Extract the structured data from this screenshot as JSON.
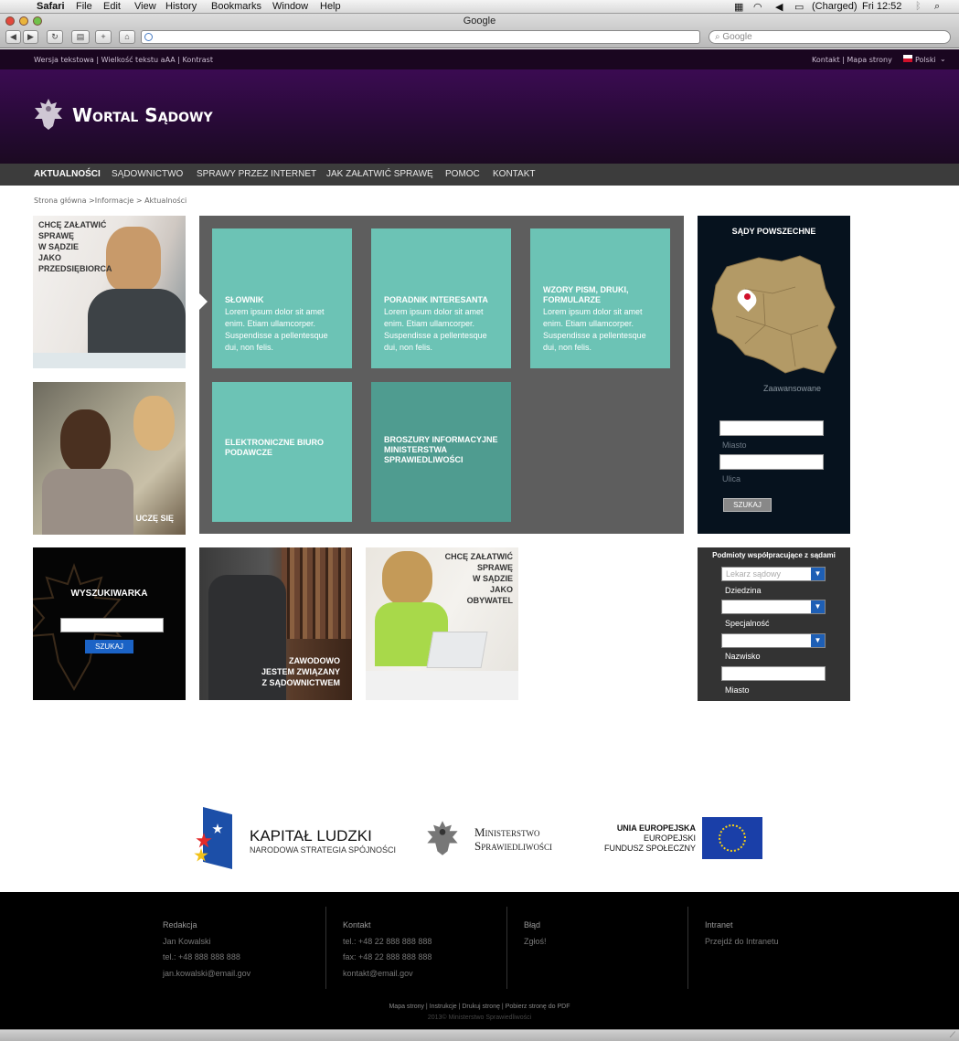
{
  "menubar": {
    "app": "Safari",
    "items": [
      "File",
      "Edit",
      "View",
      "History",
      "Bookmarks",
      "Window",
      "Help"
    ],
    "battery": "(Charged)",
    "clock": "Fri 12:52"
  },
  "browser": {
    "title": "Google",
    "search_placeholder": "Google"
  },
  "topbar": {
    "left": "Wersja tekstowa | Wielkość tekstu aAA | Kontrast",
    "right": "Kontakt | Mapa strony",
    "lang": "Polski"
  },
  "site": {
    "title": "Wortal Sądowy"
  },
  "nav": [
    "AKTUALNOŚCI",
    "SĄDOWNICTWO",
    "SPRAWY PRZEZ INTERNET",
    "JAK ZAŁATWIĆ SPRAWĘ",
    "POMOC",
    "KONTAKT"
  ],
  "breadcrumb": "Strona główna >Informacje > Aktualności",
  "promo": {
    "business": [
      "CHCĘ ZAŁATWIĆ",
      "SPRAWĘ",
      "W SĄDZIE",
      "JAKO",
      "PRZEDSIĘBIORCA"
    ],
    "learn": "UCZĘ SIĘ",
    "pro": [
      "ZAWODOWO",
      "JESTEM ZWIĄZANY",
      "Z SĄDOWNICTWEM"
    ],
    "citizen": [
      "CHCĘ ZAŁATWIĆ",
      "SPRAWĘ",
      "W SĄDZIE",
      "JAKO",
      "OBYWATEL"
    ]
  },
  "tiles": [
    {
      "title": "SŁOWNIK",
      "body": "Lorem ipsum dolor sit amet enim. Etiam ullamcorper. Suspendisse a pellentesque dui, non felis."
    },
    {
      "title": "PORADNIK INTERESANTA",
      "body": "Lorem ipsum dolor sit amet enim. Etiam ullamcorper. Suspendisse a pellentesque dui, non felis."
    },
    {
      "title": "WZORY PISM, DRUKI, FORMULARZE",
      "body": "Lorem ipsum dolor sit amet enim. Etiam ullamcorper. Suspendisse a pellentesque dui, non felis."
    },
    {
      "title": "ELEKTRONICZNE BIURO PODAWCZE",
      "body": ""
    },
    {
      "title": "BROSZURY INFORMACYJNE MINISTERSTWA SPRAWIEDLIWOŚCI",
      "body": ""
    }
  ],
  "courts": {
    "title": "SĄDY POWSZECHNE",
    "advanced": "Zaawansowane",
    "city": "Miasto",
    "street": "Ulica",
    "button": "SZUKAJ"
  },
  "searchbox": {
    "title": "WYSZUKIWARKA",
    "button": "SZUKAJ"
  },
  "entities": {
    "title": "Podmioty współpracujące z sądami",
    "placeholder": "Lekarz sądowy",
    "field": "Dziedzina",
    "spec": "Specjalność",
    "surname": "Nazwisko",
    "city": "Miasto"
  },
  "logos": {
    "kl_title": "KAPITAŁ LUDZKI",
    "kl_sub": "NARODOWA STRATEGIA SPÓJNOŚCI",
    "ms1": "Ministerstwo",
    "ms2": "Sprawiedliwości",
    "eu1": "UNIA EUROPEJSKA",
    "eu2": "EUROPEJSKI",
    "eu3": "FUNDUSZ SPOŁECZNY"
  },
  "footer": {
    "cols": [
      {
        "title": "Redakcja",
        "lines": [
          "Jan Kowalski",
          "tel.: +48 888 888 888",
          "jan.kowalski@email.gov"
        ]
      },
      {
        "title": "Kontakt",
        "lines": [
          "tel.: +48 22 888 888 888",
          "fax: +48 22 888 888 888",
          "kontakt@email.gov"
        ]
      },
      {
        "title": "Błąd",
        "lines": [
          "Zgłoś!"
        ]
      },
      {
        "title": "Intranet",
        "lines": [
          "Przejdź do Intranetu"
        ]
      }
    ],
    "links": "Mapa strony | Instrukcje | Drukuj stronę | Pobierz stronę do PDF",
    "copyright": "2013© Ministerstwo Sprawiedliwości"
  },
  "colors": {
    "purple": "#3b0b52",
    "teal": "#6cc3b5",
    "teal_dark": "#4f9c90",
    "navy": "#06121e",
    "gray": "#5e5e5e"
  }
}
